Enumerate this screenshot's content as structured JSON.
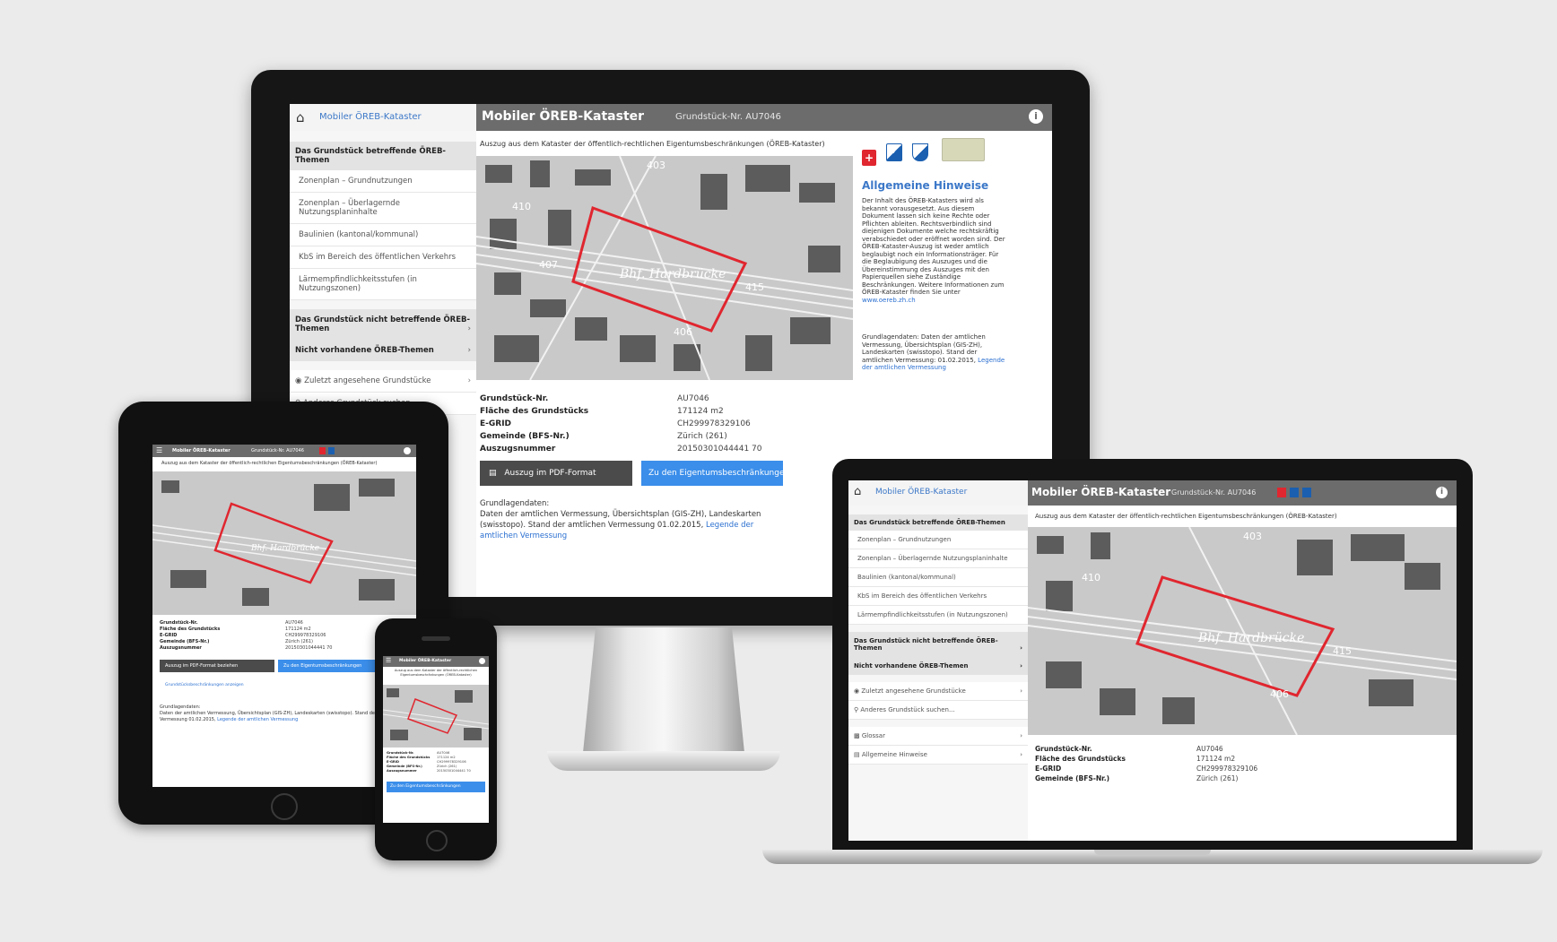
{
  "app": {
    "title": "Mobiler ÖREB-Kataster",
    "parcel_label": "Grundstück-Nr. AU7046",
    "parcel_label_short": "Grundstück-Nr. AU7046",
    "extract_title": "Auszug aus dem Kataster der öffentlich-rechtlichen Eigentumsbeschränkungen (ÖREB-Kataster)"
  },
  "sidebar": {
    "affected_header": "Das Grundstück betreffende ÖREB-Themen",
    "affected_items": [
      "Zonenplan – Grundnutzungen",
      "Zonenplan – Überlagernde Nutzungsplaninhalte",
      "Baulinien (kantonal/kommunal)",
      "KbS im Bereich des öffentlichen Verkehrs",
      "Lärmempfindlichkeitsstufen (in Nutzungszonen)"
    ],
    "not_affected_header": "Das Grundstück nicht betreffende ÖREB-Themen",
    "not_existing_header": "Nicht vorhandene ÖREB-Themen",
    "recent": "Zuletzt angesehene Grundstücke",
    "search": "Anderes Grundstück suchen...",
    "extra": [
      "Glossar",
      "Allgemeine Hinweise"
    ]
  },
  "map": {
    "label_station": "Bhf. Hardbrücke",
    "numbers": [
      "403",
      "410",
      "407",
      "415",
      "406"
    ]
  },
  "hints": {
    "title": "Allgemeine Hinweise",
    "body": "Der Inhalt des ÖREB-Katasters wird als bekannt vorausgesetzt. Aus diesem Dokument lassen sich keine Rechte oder Pflichten ableiten. Rechtsverbindlich sind diejenigen Dokumente welche rechtskräftig verabschiedet oder eröffnet worden sind. Der ÖREB-Kataster-Auszug ist weder amtlich beglaubigt noch ein Informationsträger. Für die Beglaubigung des Auszuges und die Übereinstimmung des Auszuges mit den Papierquellen siehe Zuständige Beschränkungen. Weitere Informationen zum ÖREB-Kataster finden Sie unter",
    "body_link": "www.oereb.zh.ch",
    "base_data": "Grundlagendaten: Daten der amtlichen Vermessung, Übersichtsplan (GIS-ZH), Landeskarten (swisstopo). Stand der amtlichen Vermessung: 01.02.2015,",
    "base_link": "Legende der amtlichen Vermessung"
  },
  "details": {
    "rows": [
      {
        "k": "Grundstück-Nr.",
        "v": "AU7046"
      },
      {
        "k": "Fläche des Grundstücks",
        "v": "171124 m2"
      },
      {
        "k": "E-GRID",
        "v": "CH299978329106"
      },
      {
        "k": "Gemeinde (BFS-Nr.)",
        "v": "Zürich (261)"
      },
      {
        "k": "Auszugsnummer",
        "v": "20150301044441 70"
      }
    ],
    "pdf_button": "Auszug im PDF-Format beziehen",
    "owner_button": "Zu den Eigentumsbeschränkungen",
    "owner_button_short": "Zu den Eigentumsbeschränkungen",
    "base_title": "Grundlagendaten:",
    "base_text": "Daten der amtlichen Vermessung, Übersichtsplan (GIS-ZH), Landeskarten (swisstopo). Stand der amtlichen Vermessung 01.02.2015,",
    "base_link": "Legende der amtlichen Vermessung",
    "tablet_link": "Grundstücksbeschränkungen anzeigen"
  },
  "colors": {
    "accent": "#3b8eea",
    "topbar": "#6c6c6c",
    "parcel": "#e0262f"
  },
  "icons": [
    "home-icon",
    "info-icon",
    "menu-icon",
    "chevron-right-icon",
    "eye-icon",
    "search-icon",
    "pdf-icon",
    "flag-ch-icon",
    "flag-zh-icon"
  ]
}
